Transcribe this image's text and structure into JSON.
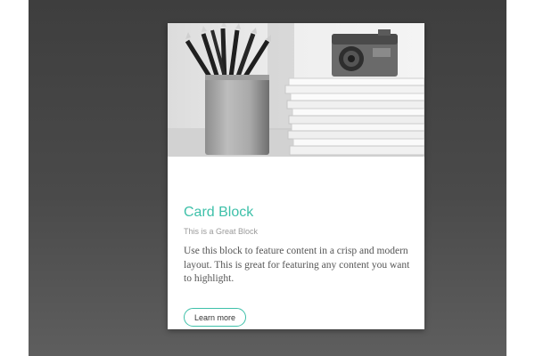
{
  "card": {
    "title": "Card Block",
    "subtitle": "This is a Great Block",
    "body": "Use this block to feature content in a crisp and modern layout. This is great for featuring any content you want to highlight.",
    "button_label": "Learn more",
    "image_icon": "desk-photo-pencils-magazines-camera"
  },
  "colors": {
    "accent": "#3ec0a9",
    "background_top": "#3e3e3e",
    "background_bottom": "#5e5e5e",
    "card_background": "#ffffff",
    "body_text": "#555555",
    "subtitle_text": "#9a9a9a"
  }
}
